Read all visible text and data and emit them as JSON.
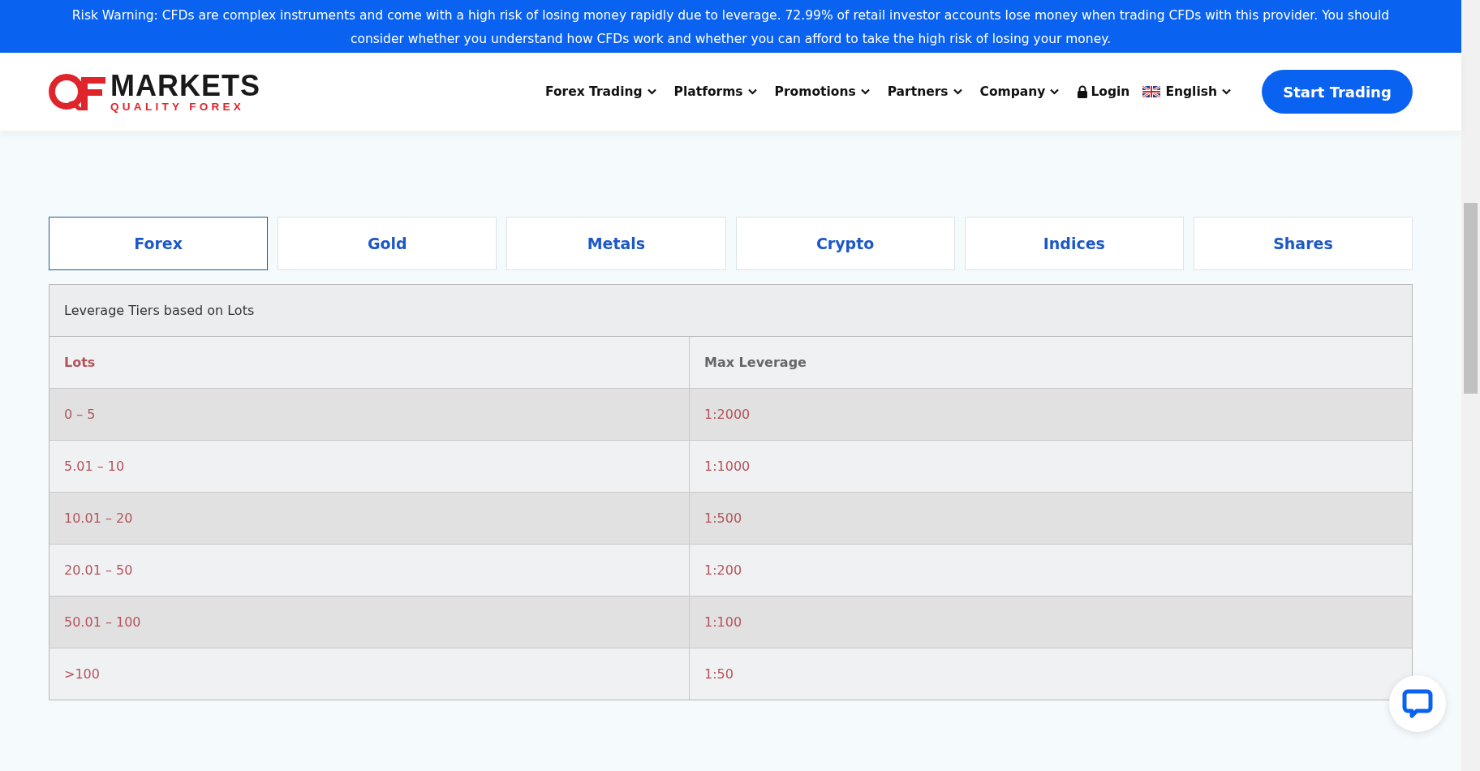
{
  "risk_warning": "Risk Warning: CFDs are complex instruments and come with a high risk of losing money rapidly due to leverage. 72.99% of retail investor accounts lose money when trading CFDs with this provider. You should consider whether you understand how CFDs work and whether you can afford to take the high risk of losing your money.",
  "logo": {
    "name": "MARKETS",
    "tagline": "QUALITY FOREX"
  },
  "nav": [
    {
      "label": "Forex Trading",
      "kind": "dropdown"
    },
    {
      "label": "Platforms",
      "kind": "dropdown"
    },
    {
      "label": "Promotions",
      "kind": "dropdown"
    },
    {
      "label": "Partners",
      "kind": "dropdown"
    },
    {
      "label": "Company",
      "kind": "dropdown"
    },
    {
      "label": "Login",
      "kind": "login"
    },
    {
      "label": "English",
      "kind": "language"
    }
  ],
  "cta": "Start Trading",
  "tabs": [
    {
      "label": "Forex",
      "selected": true
    },
    {
      "label": "Gold",
      "selected": false
    },
    {
      "label": "Metals",
      "selected": false
    },
    {
      "label": "Crypto",
      "selected": false
    },
    {
      "label": "Indices",
      "selected": false
    },
    {
      "label": "Shares",
      "selected": false
    }
  ],
  "table": {
    "caption": "Leverage Tiers based on Lots",
    "columns": [
      "Lots",
      "Max Leverage"
    ],
    "rows": [
      [
        "0 – 5",
        "1:2000"
      ],
      [
        "5.01 – 10",
        "1:1000"
      ],
      [
        "10.01 – 20",
        "1:500"
      ],
      [
        "20.01 – 50",
        "1:200"
      ],
      [
        "50.01 – 100",
        "1:100"
      ],
      [
        ">100",
        "1:50"
      ]
    ]
  }
}
